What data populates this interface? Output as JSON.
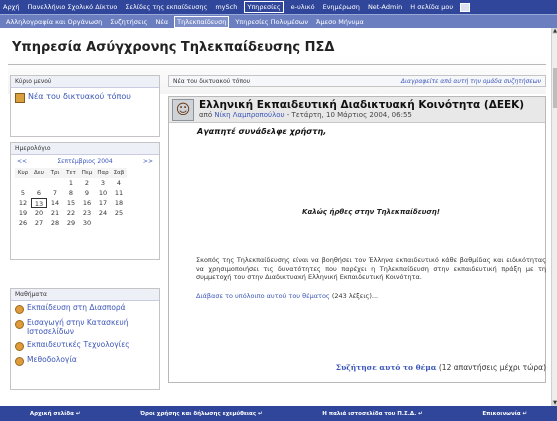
{
  "topnav1": {
    "items": [
      "Αρχή",
      "Πανελλήνιο Σχολικό Δίκτυο",
      "Σελίδες της εκπαίδευσης",
      "mySch",
      "Υπηρεσίες",
      "e-υλικό",
      "Ενημέρωση",
      "Net-Admin",
      "Η σελίδα μου"
    ],
    "active_index": 4
  },
  "topnav2": {
    "items": [
      "Αλληλογραφία και Οργάνωση",
      "Συζητήσεις",
      "Νέα",
      "Τηλεκπαίδευση",
      "Υπηρεσίες Πολυμέσων",
      "Άμεσο Μήνυμα"
    ],
    "active_index": 3
  },
  "page_title": "Υπηρεσία Ασύγχρονης Τηλεκπαίδευσης ΠΣΔ",
  "main_menu": {
    "heading": "Κύριο μενού",
    "item": "Νέα του δικτυακού τόπου"
  },
  "calendar": {
    "heading": "Ημερολόγιο",
    "prev": "<<",
    "month": "Σεπτέμβριος 2004",
    "next": ">>",
    "days": [
      "Κυρ",
      "Δευ",
      "Τρι",
      "Τετ",
      "Πεμ",
      "Παρ",
      "Σαβ"
    ],
    "weeks": [
      [
        "",
        "",
        "",
        "1",
        "2",
        "3",
        "4"
      ],
      [
        "5",
        "6",
        "7",
        "8",
        "9",
        "10",
        "11"
      ],
      [
        "12",
        "13",
        "14",
        "15",
        "16",
        "17",
        "18"
      ],
      [
        "19",
        "20",
        "21",
        "22",
        "23",
        "24",
        "25"
      ],
      [
        "26",
        "27",
        "28",
        "29",
        "30",
        "",
        ""
      ]
    ],
    "today": "13"
  },
  "lessons": {
    "heading": "Μαθήματα",
    "items": [
      "Εκπαίδευση στη Διασπορά",
      "Εισαγωγή στην Κατασκευή Ιστοσελίδων",
      "Εκπαιδευτικές Τεχνολογίες",
      "Μεθοδολογία"
    ]
  },
  "forum": {
    "label": "Νέα του δικτυακού τόπου",
    "unsubscribe": "Διαγραφείτε από αυτή την ομάδα συζητήσεων"
  },
  "post": {
    "subject": "Ελληνική Εκπαιδευτική Διαδικτυακή Κοινότητα (ΔΕΕΚ)",
    "by": "από",
    "author": "Νίκη Λαμπροπούλου",
    "date": " - Τετάρτη, 10 Μάρτιος 2004, 06:55",
    "greeting": "Αγαπητέ συνάδελφε χρήστη,",
    "welcome": "Καλώς ήρθες στην Τηλεκπαίδευση!",
    "body": "Σκοπός της Τηλεκπαίδευσης είναι να βοηθήσει τον Έλληνα εκπαιδευτικό κάθε βαθμίδας και ειδικότητας να χρησιμοποιήσει τις δυνατότητες που παρέχει η Τηλεκπαίδευση στην εκπαιδευτική πράξη με τη συμμετοχή του στην Διαδικτυακή Ελληνική Εκπαιδευτική Κοινότητα.",
    "read_more": "Διάβασε το υπόλοιπο αυτού του θέματος",
    "read_more_count": " (243 λέξεις)...",
    "discuss": "Συζήτησε αυτό το θέμα",
    "discuss_count": " (12 απαντήσεις μέχρι τώρα)"
  },
  "footer": {
    "items": [
      "Αρχική σελίδα ↵",
      "Όροι χρήσης και δήλωσης εχεμύθειας ↵",
      "Η παλιά ιστοσελίδα του Π.Σ.Δ. ↵",
      "Επικοινωνία ↵"
    ]
  },
  "colors": {
    "nav_dark": "#30469a",
    "nav_light": "#6b7ec0",
    "link": "#3a55b8"
  }
}
